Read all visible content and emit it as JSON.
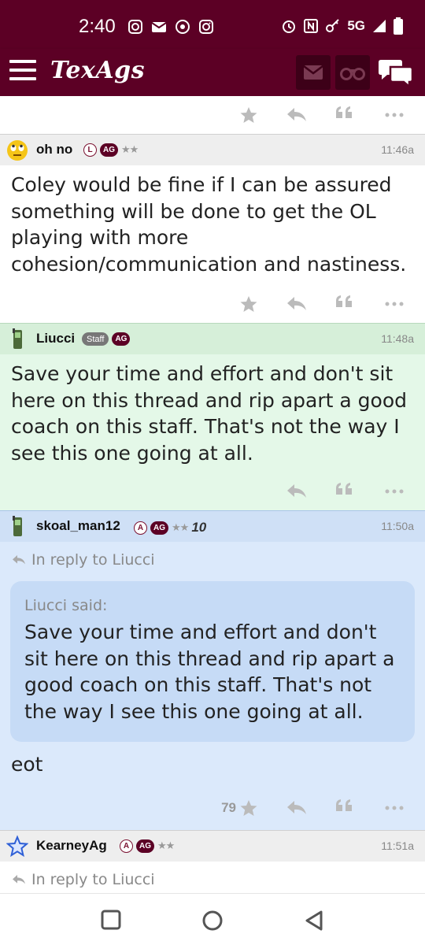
{
  "status_bar": {
    "time": "2:40",
    "network": "5G",
    "left_icons": [
      "instagram-icon",
      "mail-icon",
      "chrome-icon",
      "instagram-icon"
    ],
    "right_icons": [
      "alarm-icon",
      "nfc-icon",
      "key-icon",
      "signal-icon",
      "battery-icon"
    ]
  },
  "app": {
    "logo": "TexAgs",
    "brand_color": "#5c0025",
    "header_icons": [
      "menu-icon",
      "mail-icon",
      "binoculars-icon",
      "chat-icon"
    ]
  },
  "posts": [
    {
      "user": "oh no",
      "avatar": "rolling-eyes-emoji",
      "badges": [
        "L",
        "AG"
      ],
      "stars": "★★",
      "time": "11:46a",
      "body": "Coley would be fine if I can be assured something will be done to get the OL playing with more cohesion/communication and nastiness.",
      "bg": "#ffffff",
      "header_bg": "#eeeeee"
    },
    {
      "user": "Liucci",
      "avatar": "phone-icon",
      "badges": [
        "Staff",
        "AG"
      ],
      "time": "11:48a",
      "body": "Save your time and effort and don't sit here on this thread and rip apart a good coach on this staff. That's not the way I see this one going at all.",
      "bg": "#e4f8e8",
      "header_bg": "#d6efd9"
    },
    {
      "user": "skoal_man12",
      "avatar": "phone-icon",
      "badges": [
        "A",
        "AG"
      ],
      "stars": "★★",
      "extra": "10",
      "time": "11:50a",
      "reply_to": "In reply to Liucci",
      "quote_author": "Liucci said:",
      "quote_body": "Save your time and effort and don't sit here on this thread and rip apart a good coach on this staff. That's not the way I see this one going at all.",
      "body": "eot",
      "like_count": "79",
      "bg": "#dbe9fb",
      "header_bg": "#cfe0f6",
      "quote_bg": "#c6dbf6"
    },
    {
      "user": "KearneyAg",
      "avatar": "star-outline-icon",
      "badges": [
        "A",
        "AG"
      ],
      "stars": "★★",
      "time": "11:51a",
      "reply_to": "In reply to Liucci",
      "bg": "#ffffff",
      "header_bg": "#eeeeee"
    }
  ],
  "nav_bar": {
    "icons": [
      "recents-icon",
      "home-icon",
      "back-icon"
    ]
  }
}
